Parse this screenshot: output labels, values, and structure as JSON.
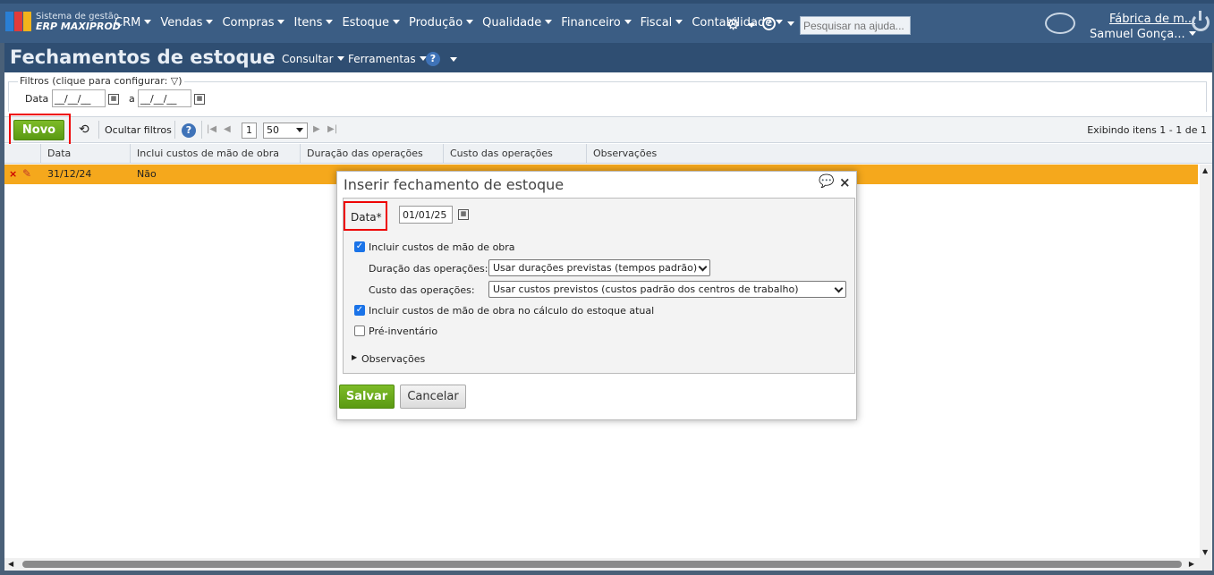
{
  "brand": {
    "line1": "Sistema de gestão",
    "line2": "ERP MAXIPROD"
  },
  "nav": [
    "CRM",
    "Vendas",
    "Compras",
    "Itens",
    "Estoque",
    "Produção",
    "Qualidade",
    "Financeiro",
    "Fiscal",
    "Contabilidade"
  ],
  "search_top": {
    "placeholder": "Pesquisar na ajuda..."
  },
  "account": {
    "company": "Fábrica de m...",
    "user": "Samuel Gonça..."
  },
  "page": {
    "title": "Fechamentos de estoque",
    "menu_consultar": "Consultar",
    "menu_ferramentas": "Ferramentas"
  },
  "filters": {
    "legend": "Filtros (clique para configurar:",
    "date_label": "Data",
    "date_from": "__/__/__",
    "sep": "a",
    "date_to": "__/__/__"
  },
  "toolbar": {
    "novo": "Novo",
    "ocultar": "Ocultar filtros",
    "page": "1",
    "per_page": "50",
    "exibindo": "Exibindo itens 1 - 1 de 1"
  },
  "table": {
    "columns": [
      "Data",
      "Inclui custos de mão de obra",
      "Duração das operações",
      "Custo das operações",
      "Observações"
    ],
    "rows": [
      {
        "data": "31/12/24",
        "inclui": "Não"
      }
    ]
  },
  "modal": {
    "title": "Inserir fechamento de estoque",
    "data_label": "Data*",
    "data_value": "01/01/25",
    "cb_mao_obra": "Incluir custos de mão de obra",
    "duracao_label": "Duração das operações:",
    "duracao_value": "Usar durações previstas (tempos padrão)",
    "custo_label": "Custo das operações:",
    "custo_value": "Usar custos previstos (custos padrão dos centros de trabalho)",
    "cb_calculo": "Incluir custos de mão de obra no cálculo do estoque atual",
    "cb_pre": "Pré-inventário",
    "observacoes": "Observações",
    "salvar": "Salvar",
    "cancelar": "Cancelar"
  },
  "colors": {
    "nav": "#3b5d84",
    "title": "#2f4e72",
    "row_selected": "#f5a81c",
    "green": "#6aa91a",
    "highlight": "#e00000"
  }
}
